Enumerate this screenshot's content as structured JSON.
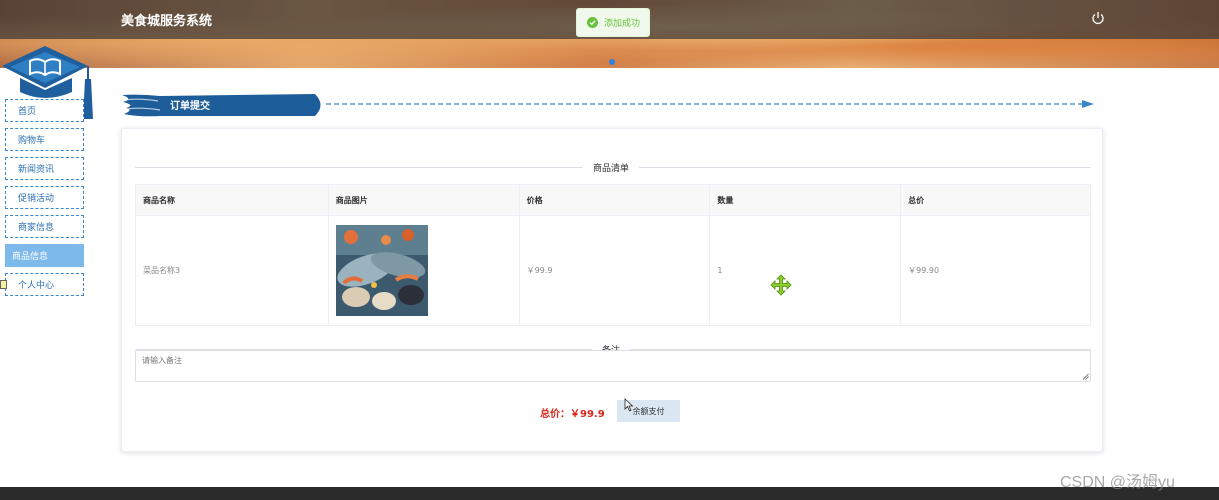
{
  "header": {
    "site_title": "美食城服务系统",
    "toast_message": "添加成功"
  },
  "sidebar": {
    "items": [
      {
        "label": "首页"
      },
      {
        "label": "购物车"
      },
      {
        "label": "新闻资讯"
      },
      {
        "label": "促销活动"
      },
      {
        "label": "商家信息"
      },
      {
        "label": "商品信息",
        "active": true
      },
      {
        "label": "个人中心"
      }
    ]
  },
  "section": {
    "title": "订单提交"
  },
  "goods": {
    "divider_label": "商品清单",
    "columns": [
      "商品名称",
      "商品图片",
      "价格",
      "数量",
      "总价"
    ],
    "rows": [
      {
        "name": "菜品名称3",
        "price": "￥99.9",
        "quantity": "1",
        "total": "￥99.90"
      }
    ]
  },
  "remark": {
    "divider_label": "备注",
    "placeholder": "请输入备注"
  },
  "summary": {
    "total_text": "总价：￥99.9",
    "pay_button": "余额支付"
  },
  "watermark": "CSDN @汤姆yu",
  "colors": {
    "accent_blue": "#2a6fb3",
    "active_item": "#7eb9ec",
    "total_red": "#d7261b",
    "toast_green": "#67c23a"
  }
}
